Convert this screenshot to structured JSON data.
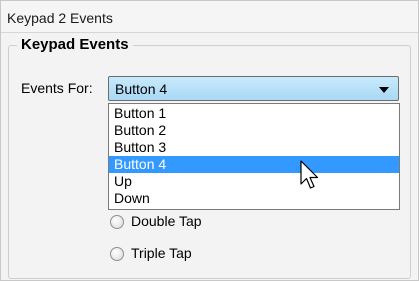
{
  "panel": {
    "title": "Keypad 2 Events"
  },
  "group": {
    "legend": "Keypad Events"
  },
  "events_for": {
    "label": "Events For:",
    "selected": "Button 4",
    "options": [
      "Button 1",
      "Button 2",
      "Button 3",
      "Button 4",
      "Up",
      "Down"
    ],
    "selected_index": 3
  },
  "radios": [
    {
      "label": "Double Tap"
    },
    {
      "label": "Triple Tap"
    }
  ],
  "icons": {
    "dropdown": "chevron-down-icon",
    "cursor": "mouse-pointer-icon"
  },
  "colors": {
    "selection": "#3399ff",
    "combobox_fill": "#b8e0f8"
  }
}
